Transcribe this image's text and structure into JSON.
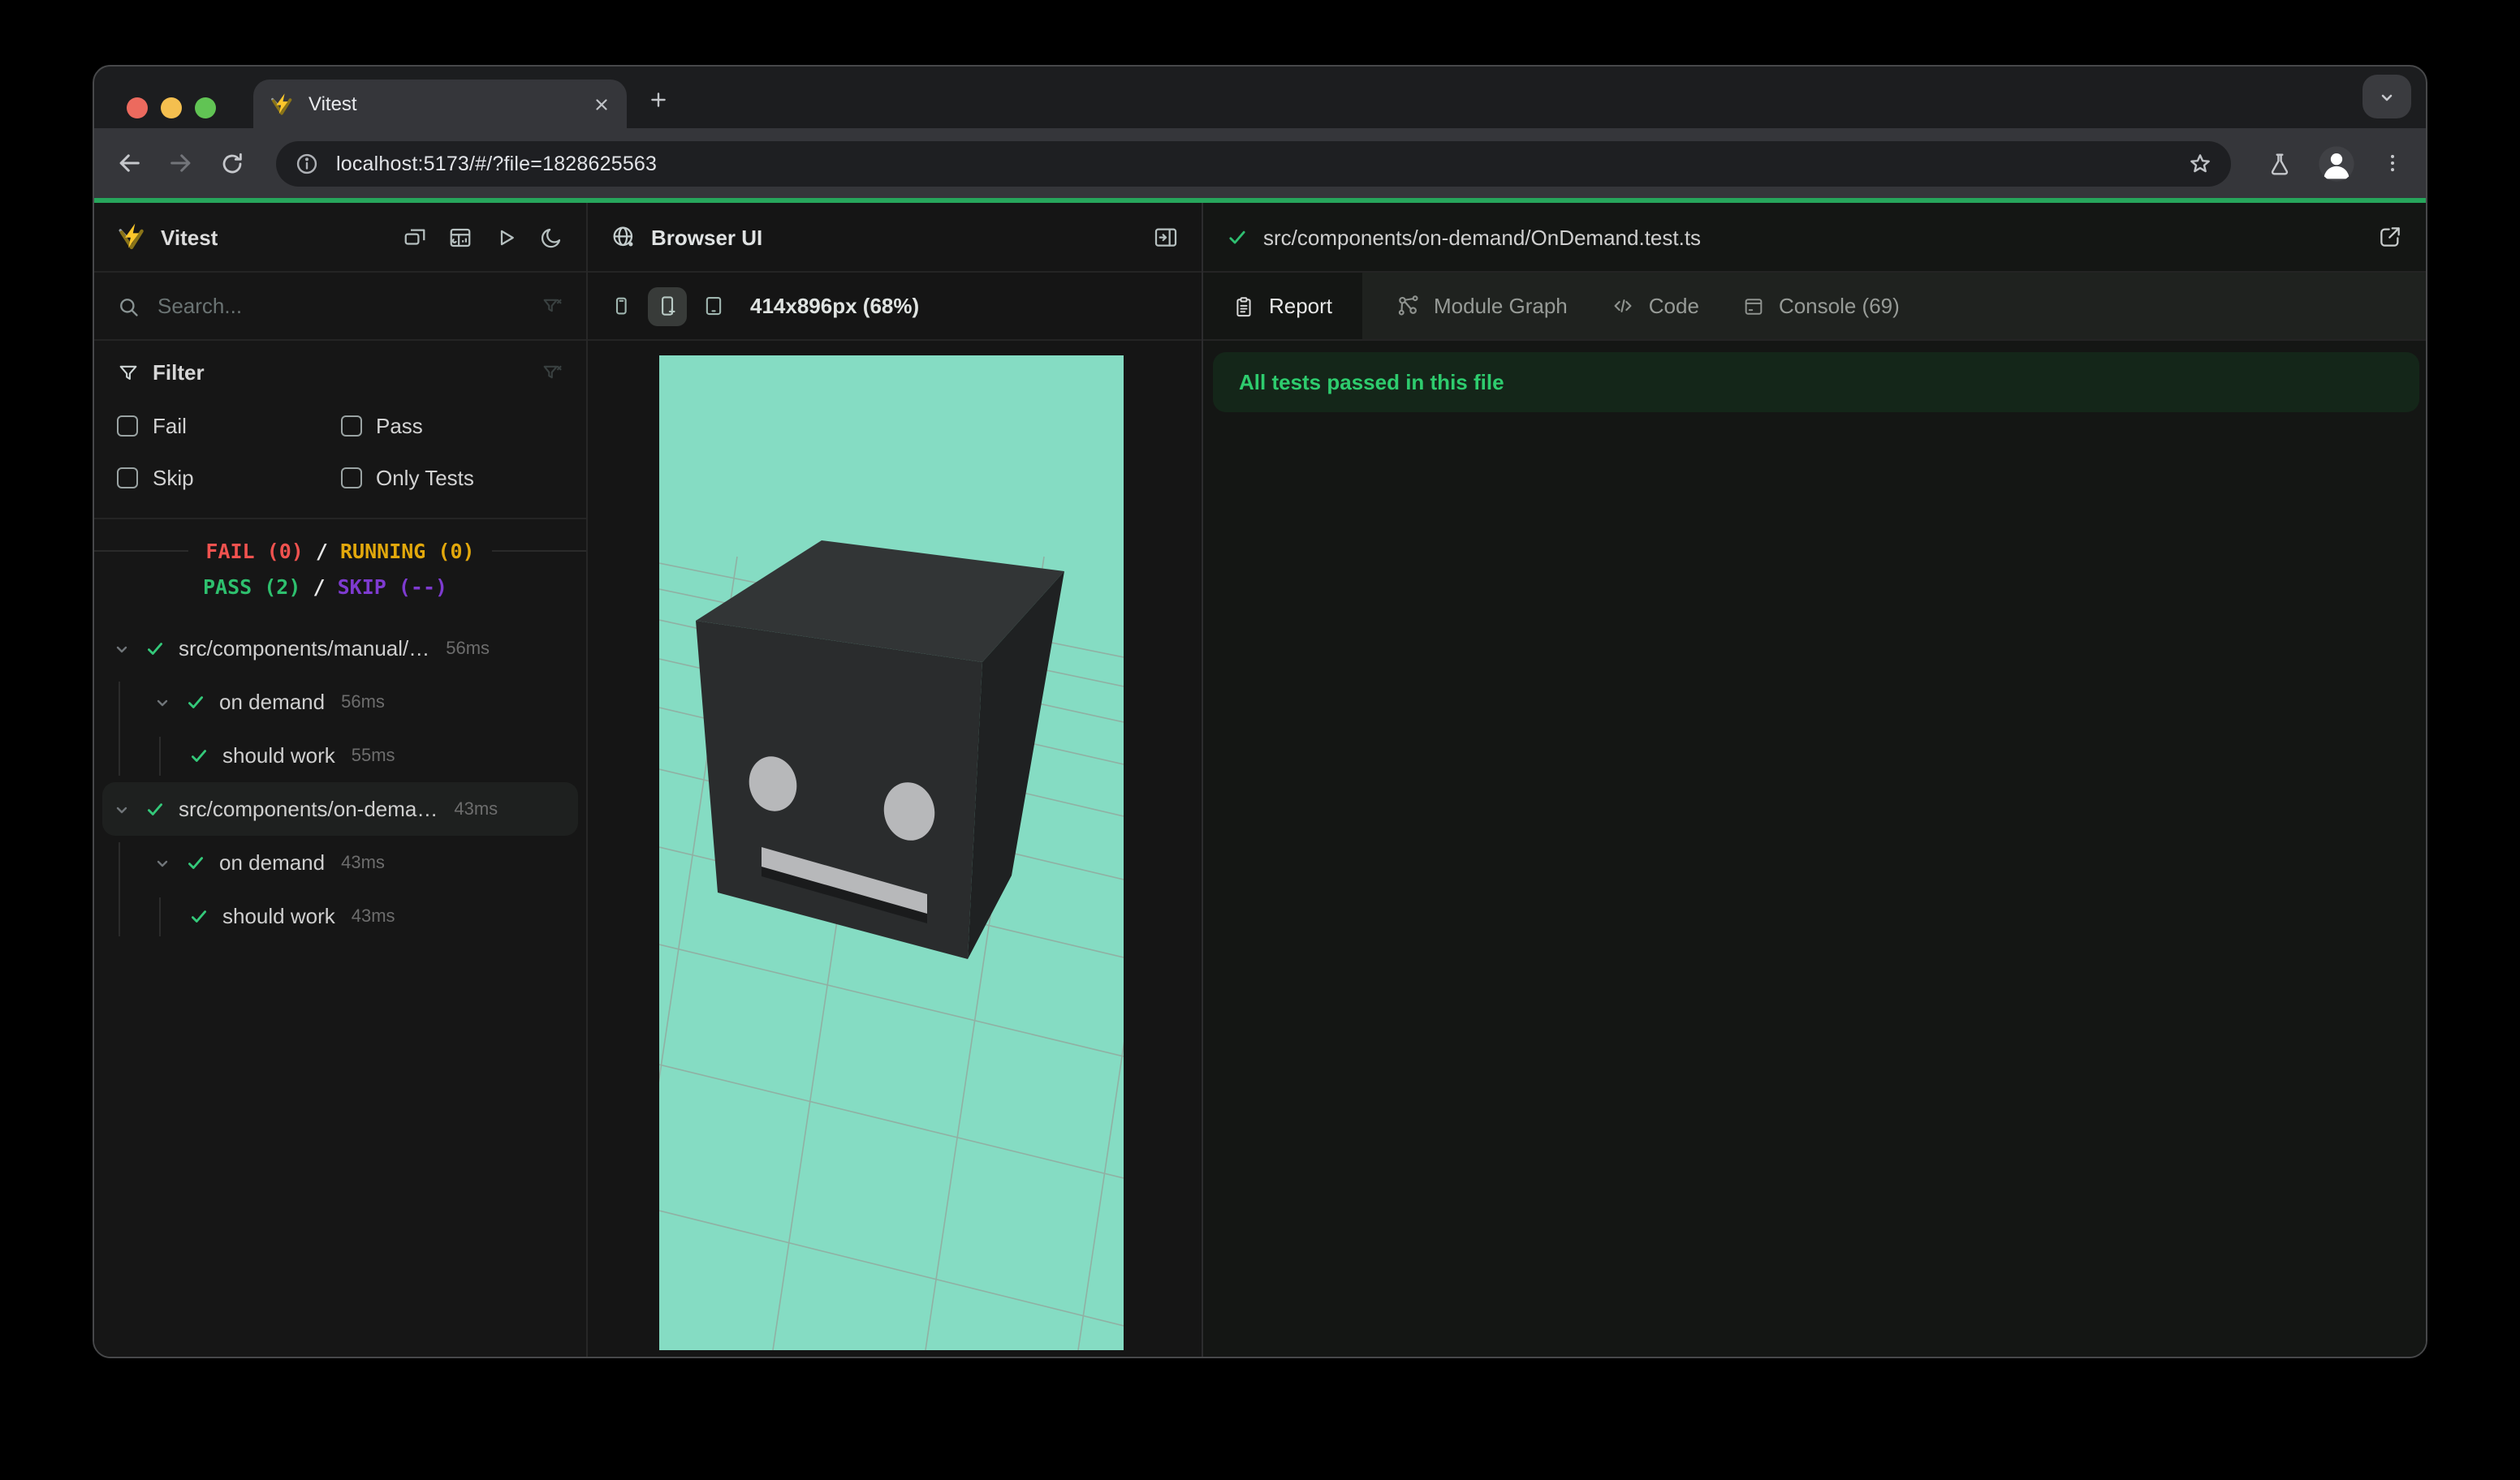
{
  "browser_chrome": {
    "tab": {
      "title": "Vitest"
    },
    "address": {
      "url": "localhost:5173/#/?file=1828625563"
    }
  },
  "sidebar": {
    "app_title": "Vitest",
    "search": {
      "placeholder": "Search..."
    },
    "filter": {
      "title": "Filter",
      "options": [
        {
          "label": "Fail",
          "checked": false
        },
        {
          "label": "Pass",
          "checked": false
        },
        {
          "label": "Skip",
          "checked": false
        },
        {
          "label": "Only Tests",
          "checked": false
        }
      ]
    },
    "status": {
      "fail": "FAIL (0)",
      "sep": " / ",
      "running": "RUNNING (0)",
      "pass": "PASS (2)",
      "skip": "SKIP (--)"
    },
    "tree": [
      {
        "label": "src/components/manual/…",
        "time": "56ms",
        "level": 0,
        "selected": false
      },
      {
        "label": "on demand",
        "time": "56ms",
        "level": 1,
        "selected": false
      },
      {
        "label": "should work",
        "time": "55ms",
        "level": 2,
        "selected": false
      },
      {
        "label": "src/components/on-dema…",
        "time": "43ms",
        "level": 0,
        "selected": true
      },
      {
        "label": "on demand",
        "time": "43ms",
        "level": 1,
        "selected": false
      },
      {
        "label": "should work",
        "time": "43ms",
        "level": 2,
        "selected": false
      }
    ]
  },
  "browser_panel": {
    "title": "Browser UI",
    "viewport_label": "414x896px (68%)"
  },
  "report_panel": {
    "file_path": "src/components/on-demand/OnDemand.test.ts",
    "tabs": [
      {
        "label": "Report",
        "active": true
      },
      {
        "label": "Module Graph",
        "active": false
      },
      {
        "label": "Code",
        "active": false
      },
      {
        "label": "Console (69)",
        "active": false
      }
    ],
    "banner": "All tests passed in this file"
  },
  "icons": {
    "traffic_lights": [
      "close",
      "minimize",
      "zoom"
    ],
    "named": [
      "search-icon",
      "funnel-icon",
      "funnel-x-icon",
      "chevron-down-icon",
      "check-icon",
      "moon-icon",
      "play-icon",
      "panes-icon",
      "dashboard-icon",
      "globe-icon",
      "panel-right-icon",
      "phone-icon",
      "phone-plus-icon",
      "tablet-icon",
      "clipboard-icon",
      "module-graph-icon",
      "code-icon",
      "console-icon",
      "external-link-icon",
      "back-icon",
      "forward-icon",
      "reload-icon",
      "info-icon",
      "star-icon",
      "flask-icon",
      "person-icon",
      "kebab-menu-icon",
      "plus-icon",
      "close-icon",
      "vitest-logo"
    ]
  },
  "colors": {
    "theme_line": "#27a65c",
    "viewport_bg": "#85dcc3",
    "fail": "#f0524f",
    "running": "#e2a80c",
    "pass": "#2ec06e",
    "skip": "#7e3bd0",
    "banner_bg": "#142619",
    "banner_text": "#2ecc6e",
    "logo_yellow": "#fcc72b"
  }
}
